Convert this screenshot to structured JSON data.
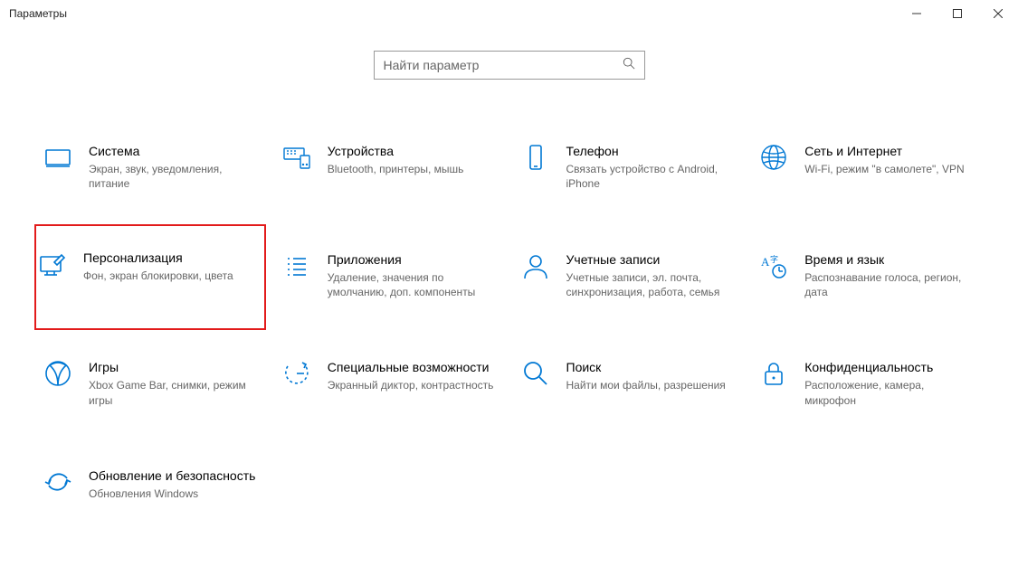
{
  "window": {
    "title": "Параметры"
  },
  "search": {
    "placeholder": "Найти параметр"
  },
  "tiles": {
    "system": {
      "title": "Система",
      "desc": "Экран, звук, уведомления, питание"
    },
    "devices": {
      "title": "Устройства",
      "desc": "Bluetooth, принтеры, мышь"
    },
    "phone": {
      "title": "Телефон",
      "desc": "Связать устройство с Android, iPhone"
    },
    "network": {
      "title": "Сеть и Интернет",
      "desc": "Wi-Fi, режим \"в самолете\", VPN"
    },
    "personalization": {
      "title": "Персонализация",
      "desc": "Фон, экран блокировки, цвета"
    },
    "apps": {
      "title": "Приложения",
      "desc": "Удаление, значения по умолчанию, доп. компоненты"
    },
    "accounts": {
      "title": "Учетные записи",
      "desc": "Учетные записи, эл. почта, синхронизация, работа, семья"
    },
    "time": {
      "title": "Время и язык",
      "desc": "Распознавание голоса, регион, дата"
    },
    "gaming": {
      "title": "Игры",
      "desc": "Xbox Game Bar, снимки, режим игры"
    },
    "ease": {
      "title": "Специальные возможности",
      "desc": "Экранный диктор, контрастность"
    },
    "searchcat": {
      "title": "Поиск",
      "desc": "Найти мои файлы, разрешения"
    },
    "privacy": {
      "title": "Конфиденциальность",
      "desc": "Расположение, камера, микрофон"
    },
    "update": {
      "title": "Обновление и безопасность",
      "desc": "Обновления Windows"
    }
  }
}
